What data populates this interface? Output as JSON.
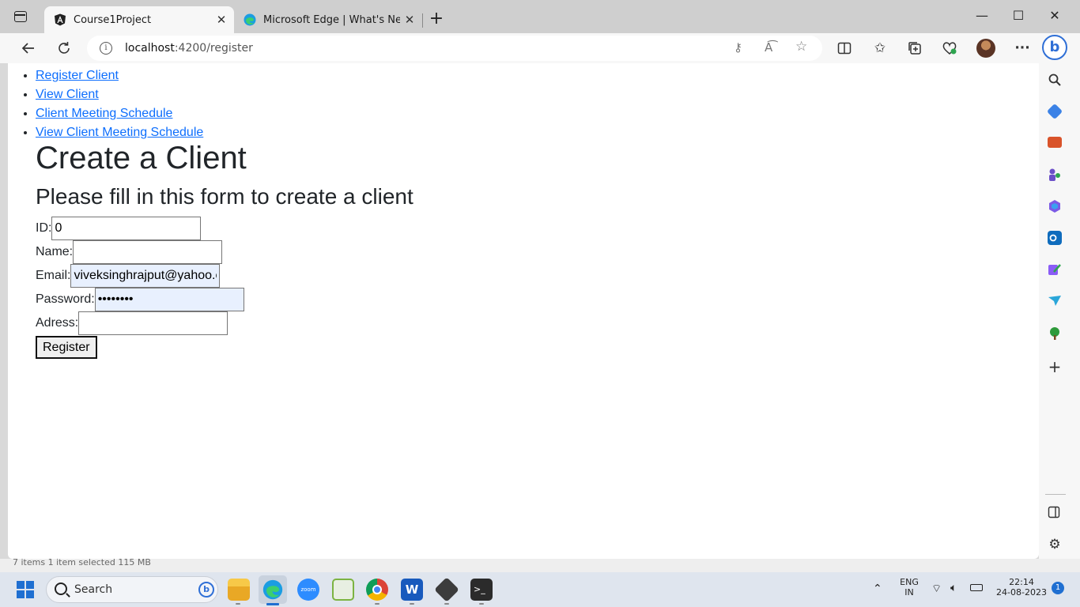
{
  "browser": {
    "tabs": [
      {
        "title": "Course1Project",
        "active": true,
        "favicon": "angular-icon"
      },
      {
        "title": "Microsoft Edge | What's New",
        "active": false,
        "favicon": "edge-icon"
      }
    ],
    "url_host": "localhost",
    "url_path": ":4200/register"
  },
  "page": {
    "nav": [
      "Register Client",
      "View Client",
      "Client Meeting Schedule",
      "View Client Meeting Schedule"
    ],
    "title": "Create a Client",
    "subtitle": "Please fill in this form to create a client",
    "form": {
      "id_label": "ID:",
      "id_value": "0",
      "name_label": "Name:",
      "name_value": "",
      "email_label": "Email:",
      "email_value": "viveksinghrajput@yahoo.com",
      "password_label": "Password:",
      "password_value": "password",
      "address_label": "Adress:",
      "address_value": "",
      "submit_label": "Register"
    }
  },
  "behind_window": {
    "status_text": "7 items     1 item selected  115 MB"
  },
  "taskbar": {
    "search_label": "Search",
    "apps": [
      "file-explorer-icon",
      "edge-icon",
      "zoom-icon",
      "notepad-plus-icon",
      "chrome-icon",
      "word-icon",
      "git-icon",
      "terminal-icon"
    ],
    "language": "ENG",
    "region": "IN",
    "time": "22:14",
    "date": "24-08-2023",
    "notification_count": "1"
  },
  "colors": {
    "link": "#0d6efd",
    "accent": "#1f6fd1",
    "autofill_bg": "#e8f0fe"
  }
}
